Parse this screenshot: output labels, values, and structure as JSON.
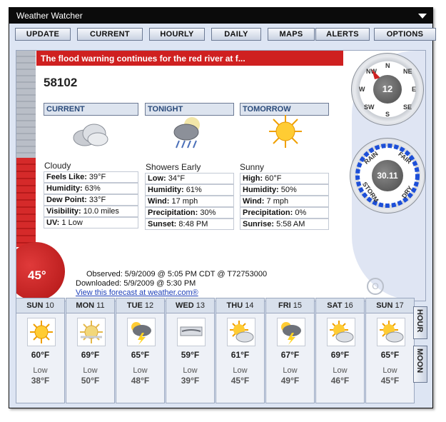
{
  "window": {
    "title": "Weather Watcher"
  },
  "nav": [
    "UPDATE",
    "CURRENT",
    "HOURLY",
    "DAILY",
    "MAPS",
    "ALERTS",
    "OPTIONS"
  ],
  "alert": "The flood warning continues for the red river at f...",
  "location": "58102",
  "thermometer": {
    "temp": "45°"
  },
  "columns": {
    "current": {
      "header": "CURRENT",
      "condition": "Cloudy",
      "icon": "cloudy-icon",
      "rows": [
        {
          "label": "Feels Like:",
          "value": "39°F"
        },
        {
          "label": "Humidity:",
          "value": "63%"
        },
        {
          "label": "Dew Point:",
          "value": "33°F"
        },
        {
          "label": "Visibility:",
          "value": "10.0 miles"
        },
        {
          "label": "UV:",
          "value": "1 Low"
        }
      ]
    },
    "tonight": {
      "header": "TONIGHT",
      "condition": "Showers Early",
      "icon": "showers-night-icon",
      "rows": [
        {
          "label": "Low:",
          "value": "34°F"
        },
        {
          "label": "Humidity:",
          "value": "61%"
        },
        {
          "label": "Wind:",
          "value": "17 mph"
        },
        {
          "label": "Precipitation:",
          "value": "30%"
        },
        {
          "label": "Sunset:",
          "value": "8:48 PM"
        }
      ]
    },
    "tomorrow": {
      "header": "TOMORROW",
      "condition": "Sunny",
      "icon": "sunny-icon",
      "rows": [
        {
          "label": "High:",
          "value": "60°F"
        },
        {
          "label": "Humidity:",
          "value": "50%"
        },
        {
          "label": "Wind:",
          "value": "7 mph"
        },
        {
          "label": "Precipitation:",
          "value": "0%"
        },
        {
          "label": "Sunrise:",
          "value": "5:58 AM"
        }
      ]
    }
  },
  "observed": "Observed: 5/9/2009 @ 5:05 PM CDT @ T72753000",
  "downloaded": "Downloaded: 5/9/2009 @ 5:30 PM",
  "link": "View this forecast at weather.com®",
  "o_button": "O",
  "compass": {
    "value": "12",
    "labels": [
      "N",
      "NE",
      "E",
      "SE",
      "S",
      "SW",
      "W",
      "NW"
    ]
  },
  "barometer": {
    "value": "30.11",
    "labels": [
      "RAIN",
      "FAIR",
      "DRY",
      "STORM"
    ]
  },
  "side_tabs": [
    "HOUR",
    "MOON"
  ],
  "forecast": [
    {
      "day": "SUN",
      "date": "10",
      "high": "60°F",
      "low_label": "Low",
      "low": "38°F",
      "icon": "sunny-icon"
    },
    {
      "day": "MON",
      "date": "11",
      "high": "69°F",
      "low_label": "Low",
      "low": "50°F",
      "icon": "hazy-sun-icon"
    },
    {
      "day": "TUE",
      "date": "12",
      "high": "65°F",
      "low_label": "Low",
      "low": "48°F",
      "icon": "thunderstorm-icon"
    },
    {
      "day": "WED",
      "date": "13",
      "high": "59°F",
      "low_label": "Low",
      "low": "39°F",
      "icon": "windy-icon"
    },
    {
      "day": "THU",
      "date": "14",
      "high": "61°F",
      "low_label": "Low",
      "low": "45°F",
      "icon": "partly-cloudy-icon"
    },
    {
      "day": "FRI",
      "date": "15",
      "high": "67°F",
      "low_label": "Low",
      "low": "49°F",
      "icon": "thunderstorm-icon"
    },
    {
      "day": "SAT",
      "date": "16",
      "high": "69°F",
      "low_label": "Low",
      "low": "46°F",
      "icon": "partly-cloudy-icon"
    },
    {
      "day": "SUN",
      "date": "17",
      "high": "65°F",
      "low_label": "Low",
      "low": "45°F",
      "icon": "partly-cloudy-icon"
    }
  ]
}
